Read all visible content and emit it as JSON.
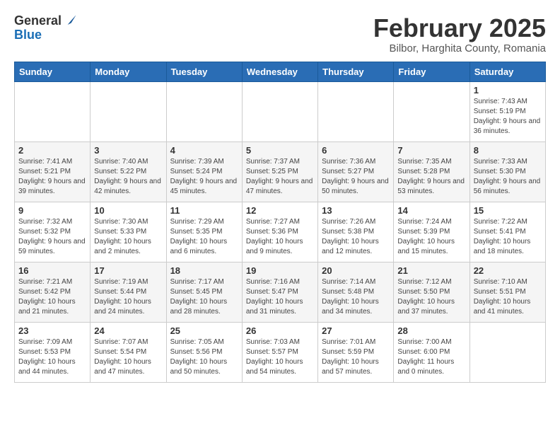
{
  "logo": {
    "general": "General",
    "blue": "Blue"
  },
  "title": "February 2025",
  "subtitle": "Bilbor, Harghita County, Romania",
  "weekdays": [
    "Sunday",
    "Monday",
    "Tuesday",
    "Wednesday",
    "Thursday",
    "Friday",
    "Saturday"
  ],
  "weeks": [
    [
      {
        "day": "",
        "info": ""
      },
      {
        "day": "",
        "info": ""
      },
      {
        "day": "",
        "info": ""
      },
      {
        "day": "",
        "info": ""
      },
      {
        "day": "",
        "info": ""
      },
      {
        "day": "",
        "info": ""
      },
      {
        "day": "1",
        "info": "Sunrise: 7:43 AM\nSunset: 5:19 PM\nDaylight: 9 hours and 36 minutes."
      }
    ],
    [
      {
        "day": "2",
        "info": "Sunrise: 7:41 AM\nSunset: 5:21 PM\nDaylight: 9 hours and 39 minutes."
      },
      {
        "day": "3",
        "info": "Sunrise: 7:40 AM\nSunset: 5:22 PM\nDaylight: 9 hours and 42 minutes."
      },
      {
        "day": "4",
        "info": "Sunrise: 7:39 AM\nSunset: 5:24 PM\nDaylight: 9 hours and 45 minutes."
      },
      {
        "day": "5",
        "info": "Sunrise: 7:37 AM\nSunset: 5:25 PM\nDaylight: 9 hours and 47 minutes."
      },
      {
        "day": "6",
        "info": "Sunrise: 7:36 AM\nSunset: 5:27 PM\nDaylight: 9 hours and 50 minutes."
      },
      {
        "day": "7",
        "info": "Sunrise: 7:35 AM\nSunset: 5:28 PM\nDaylight: 9 hours and 53 minutes."
      },
      {
        "day": "8",
        "info": "Sunrise: 7:33 AM\nSunset: 5:30 PM\nDaylight: 9 hours and 56 minutes."
      }
    ],
    [
      {
        "day": "9",
        "info": "Sunrise: 7:32 AM\nSunset: 5:32 PM\nDaylight: 9 hours and 59 minutes."
      },
      {
        "day": "10",
        "info": "Sunrise: 7:30 AM\nSunset: 5:33 PM\nDaylight: 10 hours and 2 minutes."
      },
      {
        "day": "11",
        "info": "Sunrise: 7:29 AM\nSunset: 5:35 PM\nDaylight: 10 hours and 6 minutes."
      },
      {
        "day": "12",
        "info": "Sunrise: 7:27 AM\nSunset: 5:36 PM\nDaylight: 10 hours and 9 minutes."
      },
      {
        "day": "13",
        "info": "Sunrise: 7:26 AM\nSunset: 5:38 PM\nDaylight: 10 hours and 12 minutes."
      },
      {
        "day": "14",
        "info": "Sunrise: 7:24 AM\nSunset: 5:39 PM\nDaylight: 10 hours and 15 minutes."
      },
      {
        "day": "15",
        "info": "Sunrise: 7:22 AM\nSunset: 5:41 PM\nDaylight: 10 hours and 18 minutes."
      }
    ],
    [
      {
        "day": "16",
        "info": "Sunrise: 7:21 AM\nSunset: 5:42 PM\nDaylight: 10 hours and 21 minutes."
      },
      {
        "day": "17",
        "info": "Sunrise: 7:19 AM\nSunset: 5:44 PM\nDaylight: 10 hours and 24 minutes."
      },
      {
        "day": "18",
        "info": "Sunrise: 7:17 AM\nSunset: 5:45 PM\nDaylight: 10 hours and 28 minutes."
      },
      {
        "day": "19",
        "info": "Sunrise: 7:16 AM\nSunset: 5:47 PM\nDaylight: 10 hours and 31 minutes."
      },
      {
        "day": "20",
        "info": "Sunrise: 7:14 AM\nSunset: 5:48 PM\nDaylight: 10 hours and 34 minutes."
      },
      {
        "day": "21",
        "info": "Sunrise: 7:12 AM\nSunset: 5:50 PM\nDaylight: 10 hours and 37 minutes."
      },
      {
        "day": "22",
        "info": "Sunrise: 7:10 AM\nSunset: 5:51 PM\nDaylight: 10 hours and 41 minutes."
      }
    ],
    [
      {
        "day": "23",
        "info": "Sunrise: 7:09 AM\nSunset: 5:53 PM\nDaylight: 10 hours and 44 minutes."
      },
      {
        "day": "24",
        "info": "Sunrise: 7:07 AM\nSunset: 5:54 PM\nDaylight: 10 hours and 47 minutes."
      },
      {
        "day": "25",
        "info": "Sunrise: 7:05 AM\nSunset: 5:56 PM\nDaylight: 10 hours and 50 minutes."
      },
      {
        "day": "26",
        "info": "Sunrise: 7:03 AM\nSunset: 5:57 PM\nDaylight: 10 hours and 54 minutes."
      },
      {
        "day": "27",
        "info": "Sunrise: 7:01 AM\nSunset: 5:59 PM\nDaylight: 10 hours and 57 minutes."
      },
      {
        "day": "28",
        "info": "Sunrise: 7:00 AM\nSunset: 6:00 PM\nDaylight: 11 hours and 0 minutes."
      },
      {
        "day": "",
        "info": ""
      }
    ]
  ]
}
